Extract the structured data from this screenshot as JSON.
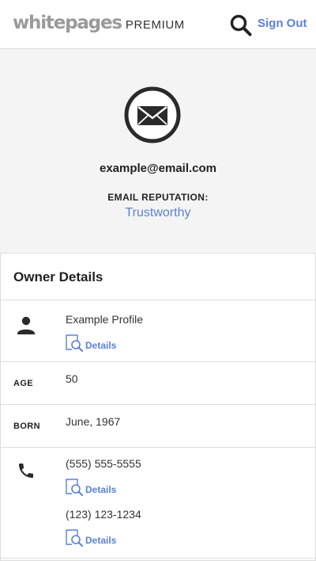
{
  "header": {
    "logo_main": "whitepages",
    "logo_sub": "PREMIUM",
    "search_icon": "search-icon",
    "sign_out_label": "Sign Out"
  },
  "hero": {
    "icon": "envelope-icon",
    "email": "example@email.com",
    "reputation_label": "EMAIL REPUTATION:",
    "reputation_value": "Trustworthy"
  },
  "owner_details": {
    "title": "Owner Details",
    "profile": {
      "icon": "person-icon",
      "name": "Example Profile",
      "details_label": "Details"
    },
    "age": {
      "label": "AGE",
      "value": "50"
    },
    "born": {
      "label": "BORN",
      "value": "June, 1967"
    },
    "phones": {
      "icon": "phone-icon",
      "items": [
        {
          "number": "(555) 555-5555",
          "details_label": "Details"
        },
        {
          "number": "(123) 123-1234",
          "details_label": "Details"
        }
      ]
    }
  },
  "colors": {
    "accent": "#5b80d6",
    "logo_gray": "#9a9a9a",
    "hero_bg": "#f4f4f4",
    "divider": "#dcdcdc"
  }
}
